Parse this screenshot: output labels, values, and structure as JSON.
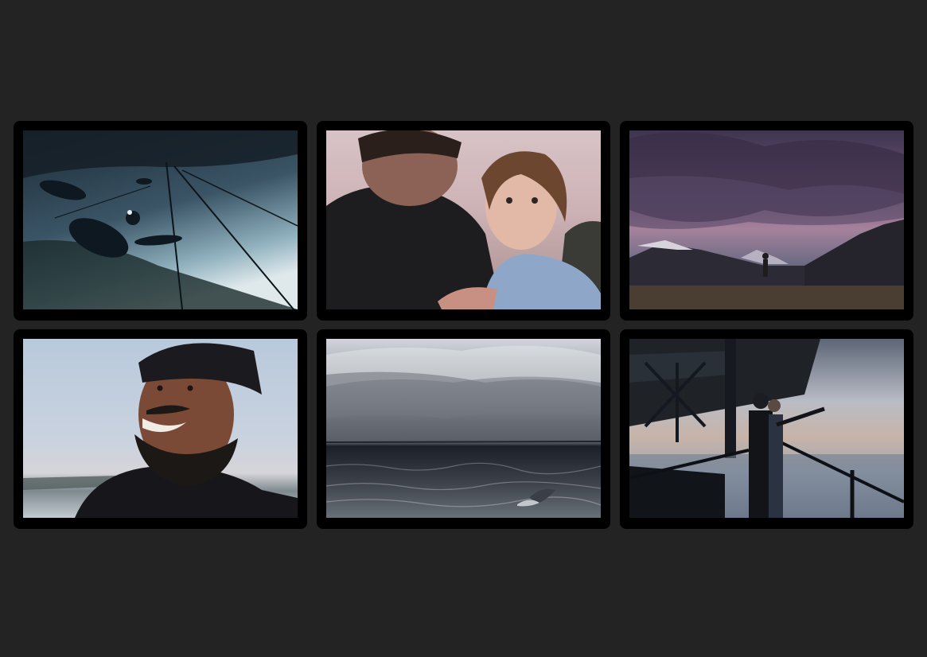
{
  "gallery": {
    "tiles": [
      {
        "icon": "underwater-cave-divers-photo"
      },
      {
        "icon": "man-holding-child-photo"
      },
      {
        "icon": "mountain-valley-storm-clouds-photo"
      },
      {
        "icon": "smiling-man-beanie-photo"
      },
      {
        "icon": "ocean-dolphin-photo"
      },
      {
        "icon": "people-on-bridge-pointing-photo"
      }
    ]
  }
}
